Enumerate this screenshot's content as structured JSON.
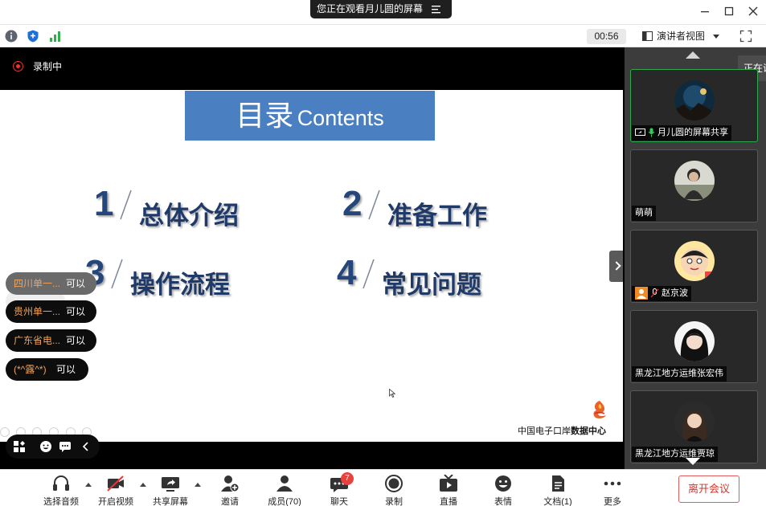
{
  "window": {
    "share_banner": "您正在观看月儿圆的屏幕"
  },
  "toolbar": {
    "timer": "00:56",
    "view_mode": "演讲者视图"
  },
  "share": {
    "recording_label": "录制中",
    "slide": {
      "title_cn": "目录",
      "title_en": "Contents",
      "items": [
        {
          "num": "1",
          "text": "总体介绍"
        },
        {
          "num": "2",
          "text": "准备工作"
        },
        {
          "num": "3",
          "text": "操作流程"
        },
        {
          "num": "4",
          "text": "常见问题"
        }
      ],
      "org_prefix": "中国电子口岸",
      "org_suffix": "数据中心"
    }
  },
  "chat": {
    "bubbles": [
      {
        "who": "四川单一...",
        "msg": "可以"
      },
      {
        "who": "贵州单一...",
        "msg": "可以"
      },
      {
        "who": "广东省电...",
        "msg": "可以"
      },
      {
        "who": "(*^露^*)",
        "msg": "可以"
      }
    ]
  },
  "participants": {
    "speaking_tip": "正在说",
    "tiles": [
      {
        "name": "月儿圆的屏幕共享"
      },
      {
        "name": "萌萌"
      },
      {
        "name": "赵京波"
      },
      {
        "name": "黑龙江地方运维张宏伟"
      },
      {
        "name": "黑龙江地方运维贾琼"
      }
    ]
  },
  "bottombar": {
    "audio": "选择音频",
    "video": "开启视频",
    "share": "共享屏幕",
    "invite": "邀请",
    "members": "成员(70)",
    "chat": "聊天",
    "chat_badge": "7",
    "record": "录制",
    "live": "直播",
    "reactions": "表情",
    "docs": "文档(1)",
    "more": "更多",
    "leave": "离开会议"
  },
  "colors": {
    "accent_blue": "#4a80c2",
    "record_red": "#e33333",
    "active_border": "#2fa84f",
    "leave_red": "#d9342b",
    "chat_name": "#f0a35b"
  }
}
